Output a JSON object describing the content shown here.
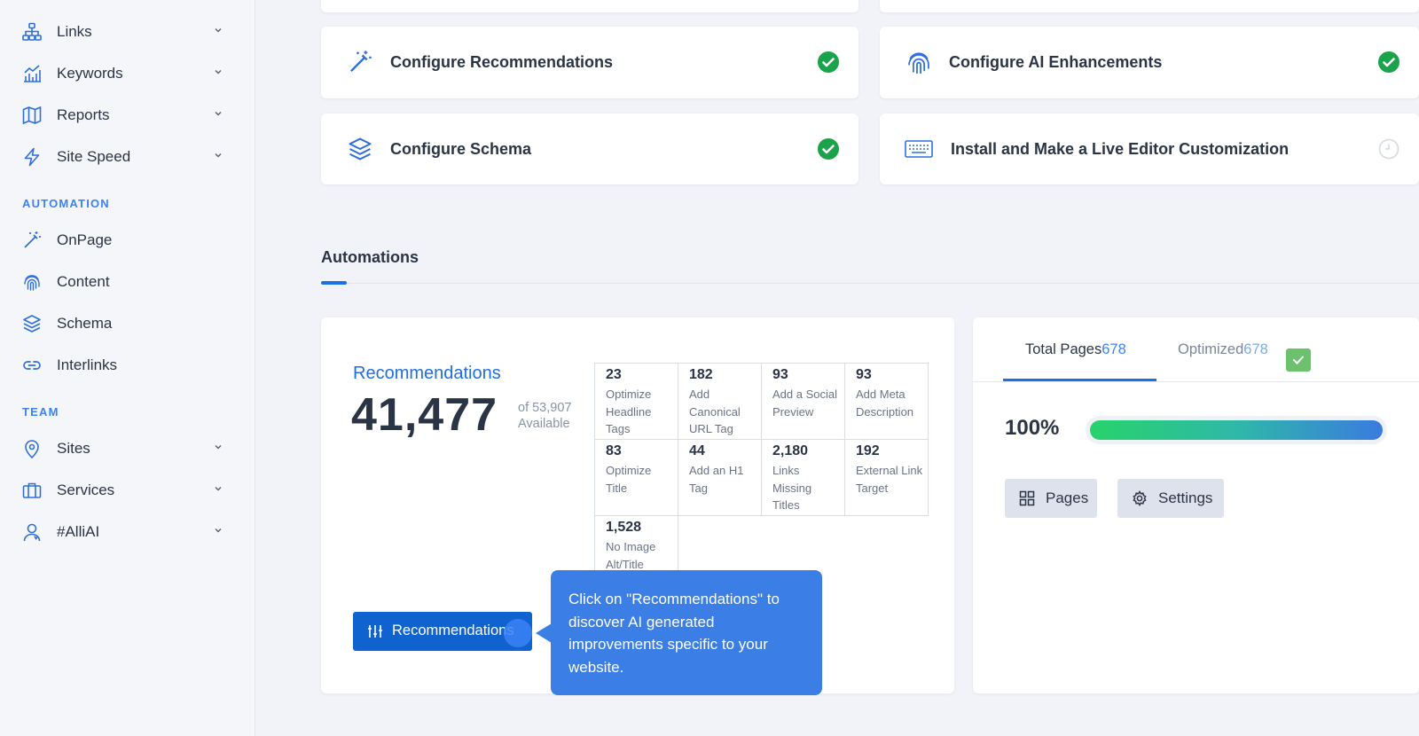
{
  "sidebar": {
    "items_main": [
      {
        "label": "Links",
        "icon": "sitemap-icon"
      },
      {
        "label": "Keywords",
        "icon": "chart-icon"
      },
      {
        "label": "Reports",
        "icon": "map-icon"
      },
      {
        "label": "Site Speed",
        "icon": "bolt-icon"
      }
    ],
    "automation_label": "AUTOMATION",
    "items_automation": [
      {
        "label": "OnPage",
        "icon": "magic-wand-icon"
      },
      {
        "label": "Content",
        "icon": "fingerprint-icon"
      },
      {
        "label": "Schema",
        "icon": "layers-icon"
      },
      {
        "label": "Interlinks",
        "icon": "link-icon"
      }
    ],
    "team_label": "TEAM",
    "items_team": [
      {
        "label": "Sites",
        "icon": "location-pin-icon"
      },
      {
        "label": "Services",
        "icon": "briefcase-icon"
      },
      {
        "label": "#AlliAI",
        "icon": "user-icon"
      }
    ]
  },
  "tasks": [
    {
      "label": "Configure Recommendations",
      "icon": "magic-wand-icon",
      "status": "complete"
    },
    {
      "label": "Configure AI Enhancements",
      "icon": "fingerprint-icon",
      "status": "complete"
    },
    {
      "label": "Configure Schema",
      "icon": "layers-icon",
      "status": "complete"
    },
    {
      "label": "Install and Make a Live Editor Customization",
      "icon": "keyboard-icon",
      "status": "pending"
    }
  ],
  "automations": {
    "title": "Automations",
    "recommendations_label": "Recommendations",
    "count": "41,477",
    "of_total": "of 53,907",
    "available": "Available",
    "grid": [
      {
        "num": "23",
        "desc": "Optimize Headline Tags"
      },
      {
        "num": "182",
        "desc": "Add Canonical URL Tag"
      },
      {
        "num": "93",
        "desc": "Add a Social Preview"
      },
      {
        "num": "93",
        "desc": "Add Meta Description"
      },
      {
        "num": "83",
        "desc": "Optimize Title"
      },
      {
        "num": "44",
        "desc": "Add an H1 Tag"
      },
      {
        "num": "2,180",
        "desc": "Links Missing Titles"
      },
      {
        "num": "192",
        "desc": "External Link Target"
      },
      {
        "num": "1,528",
        "desc": "No Image Alt/Title"
      }
    ],
    "button_label": "Recommendations",
    "tooltip": "Click on \"Recommendations\" to discover AI generated improvements specific to your website."
  },
  "pages_panel": {
    "tab_total_label": "Total Pages",
    "tab_total_value": "678",
    "tab_optimized_label": "Optimized",
    "tab_optimized_value": "678",
    "percent_text": "100%",
    "progress": 1.0,
    "pages_button": "Pages",
    "settings_button": "Settings"
  },
  "colors": {
    "accent": "#1e6fe0",
    "success": "#1aa34a",
    "tooltip": "#3b7fe6"
  }
}
